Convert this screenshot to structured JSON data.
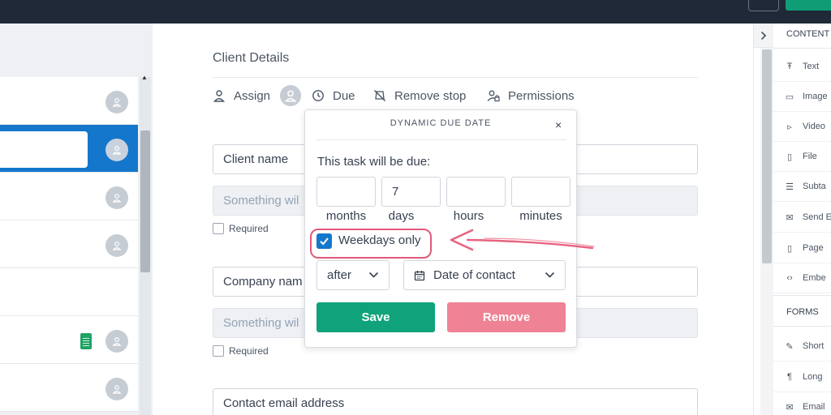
{
  "main": {
    "section_title": "Client Details",
    "toolbar": {
      "assign": "Assign",
      "due": "Due",
      "remove_stop": "Remove stop",
      "permissions": "Permissions"
    },
    "fields": [
      {
        "label": "Client name",
        "placeholder": "Something wil",
        "required": "Required"
      },
      {
        "label": "Company nam",
        "placeholder": "Something wil",
        "required": "Required"
      },
      {
        "label": "Contact email address"
      }
    ]
  },
  "popup": {
    "title": "DYNAMIC DUE DATE",
    "close": "×",
    "prompt": "This task will be due:",
    "durations": [
      {
        "value": "",
        "label": "months"
      },
      {
        "value": "7",
        "label": "days"
      },
      {
        "value": "",
        "label": "hours"
      },
      {
        "value": "",
        "label": "minutes"
      }
    ],
    "weekdays_label": "Weekdays only",
    "weekdays_checked": true,
    "relation": "after",
    "anchor": "Date of contact",
    "save": "Save",
    "remove": "Remove"
  },
  "rightpane": {
    "content_heading": "CONTENT",
    "content_items": [
      {
        "label": "Text",
        "icon": "text-icon"
      },
      {
        "label": "Image",
        "icon": "image-icon"
      },
      {
        "label": "Video",
        "icon": "video-icon"
      },
      {
        "label": "File",
        "icon": "file-icon"
      },
      {
        "label": "Subta",
        "icon": "subtask-list-icon"
      },
      {
        "label": "Send E",
        "icon": "email-icon"
      },
      {
        "label": "Page",
        "icon": "page-icon"
      },
      {
        "label": "Embe",
        "icon": "code-icon"
      }
    ],
    "forms_heading": "FORMS",
    "form_items": [
      {
        "label": "Short",
        "icon": "edit-icon"
      },
      {
        "label": "Long",
        "icon": "paragraph-icon"
      },
      {
        "label": "Email",
        "icon": "email-icon"
      }
    ]
  },
  "colors": {
    "accent_blue": "#1477cc",
    "save_green": "#10a37b",
    "remove_pink": "#ef8294",
    "highlight": "#e05a7a"
  }
}
